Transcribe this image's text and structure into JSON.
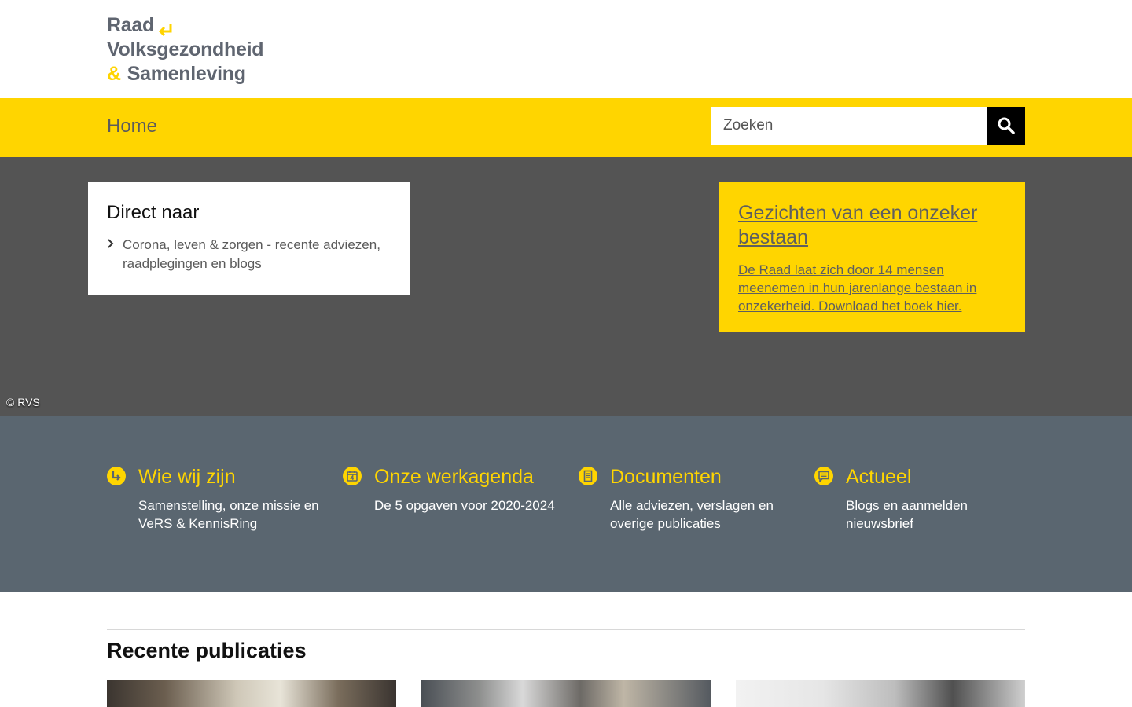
{
  "header": {
    "logo": {
      "line1": "Raad",
      "line2": "Volksgezondheid",
      "amp": "&",
      "line3": "Samenleving"
    }
  },
  "nav": {
    "home_label": "Home",
    "search_placeholder": "Zoeken"
  },
  "hero": {
    "direct": {
      "title": "Direct naar",
      "items": [
        {
          "label": "Corona, leven & zorgen - recente adviezen, raadplegingen en blogs"
        }
      ]
    },
    "feature": {
      "title": "Gezichten van een onzeker bestaan",
      "text": "De Raad laat zich door 14 mensen meenemen in hun jarenlange bestaan in onzekerheid. Download het boek hier."
    },
    "copyright": "© RVS"
  },
  "quick_links": [
    {
      "title": "Wie wij zijn",
      "description": "Samenstelling, onze missie en VeRS & KennisRing",
      "icon": "arrow-turn-icon"
    },
    {
      "title": "Onze werkagenda",
      "description": "De 5 opgaven voor 2020-2024",
      "icon": "calendar-icon"
    },
    {
      "title": "Documenten",
      "description": "Alle adviezen, verslagen en overige publicaties",
      "icon": "document-icon"
    },
    {
      "title": "Actueel",
      "description": "Blogs en aanmelden nieuwsbrief",
      "icon": "chat-icon"
    }
  ],
  "recent": {
    "title": "Recente publicaties"
  },
  "colors": {
    "brand_yellow": "#ffd500",
    "hero_gray": "#545454",
    "band_slate": "#5a6670"
  }
}
